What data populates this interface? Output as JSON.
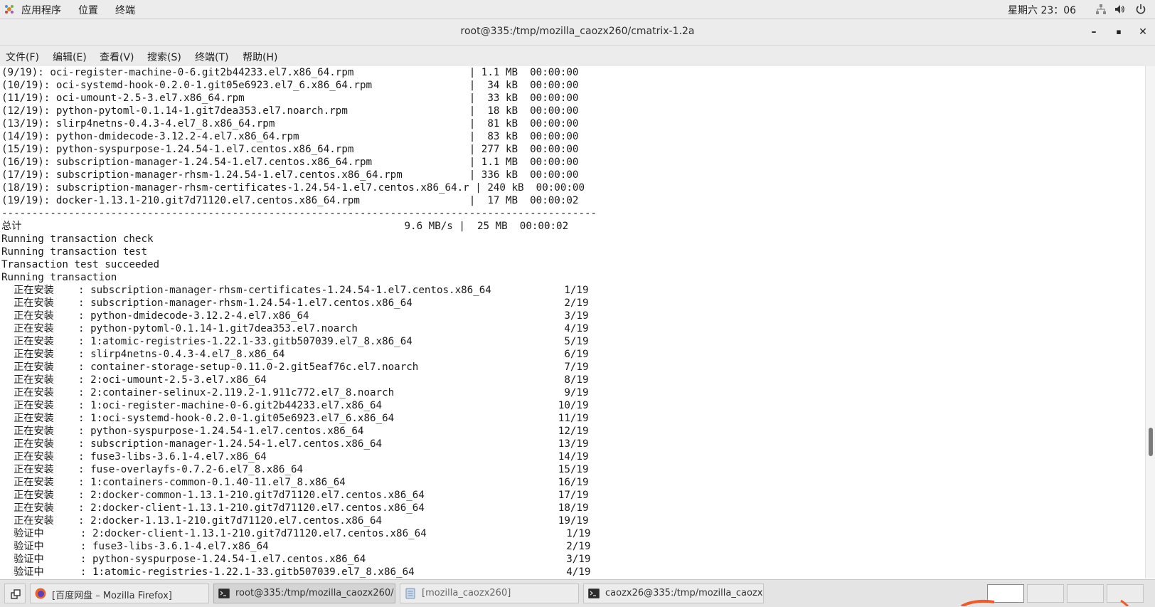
{
  "top_panel": {
    "menus": [
      "应用程序",
      "位置",
      "终端"
    ],
    "clock": "星期六 23：06"
  },
  "window": {
    "title": "root@335:/tmp/mozilla_caozx260/cmatrix-1.2a"
  },
  "menubar": [
    "文件(F)",
    "编辑(E)",
    "查看(V)",
    "搜索(S)",
    "终端(T)",
    "帮助(H)"
  ],
  "terminal_lines": [
    "(9/19): oci-register-machine-0-6.git2b44233.el7.x86_64.rpm                   | 1.1 MB  00:00:00",
    "(10/19): oci-systemd-hook-0.2.0-1.git05e6923.el7_6.x86_64.rpm                |  34 kB  00:00:00",
    "(11/19): oci-umount-2.5-3.el7.x86_64.rpm                                     |  33 kB  00:00:00",
    "(12/19): python-pytoml-0.1.14-1.git7dea353.el7.noarch.rpm                    |  18 kB  00:00:00",
    "(13/19): slirp4netns-0.4.3-4.el7_8.x86_64.rpm                                |  81 kB  00:00:00",
    "(14/19): python-dmidecode-3.12.2-4.el7.x86_64.rpm                            |  83 kB  00:00:00",
    "(15/19): python-syspurpose-1.24.54-1.el7.centos.x86_64.rpm                   | 277 kB  00:00:00",
    "(16/19): subscription-manager-1.24.54-1.el7.centos.x86_64.rpm                | 1.1 MB  00:00:00",
    "(17/19): subscription-manager-rhsm-1.24.54-1.el7.centos.x86_64.rpm           | 336 kB  00:00:00",
    "(18/19): subscription-manager-rhsm-certificates-1.24.54-1.el7.centos.x86_64.r | 240 kB  00:00:00",
    "(19/19): docker-1.13.1-210.git7d71120.el7.centos.x86_64.rpm                  |  17 MB  00:00:02",
    "--------------------------------------------------------------------------------------------------",
    "总计                                                               9.6 MB/s |  25 MB  00:00:02",
    "Running transaction check",
    "Running transaction test",
    "Transaction test succeeded",
    "Running transaction",
    "  正在安装    : subscription-manager-rhsm-certificates-1.24.54-1.el7.centos.x86_64            1/19",
    "  正在安装    : subscription-manager-rhsm-1.24.54-1.el7.centos.x86_64                         2/19",
    "  正在安装    : python-dmidecode-3.12.2-4.el7.x86_64                                          3/19",
    "  正在安装    : python-pytoml-0.1.14-1.git7dea353.el7.noarch                                  4/19",
    "  正在安装    : 1:atomic-registries-1.22.1-33.gitb507039.el7_8.x86_64                         5/19",
    "  正在安装    : slirp4netns-0.4.3-4.el7_8.x86_64                                              6/19",
    "  正在安装    : container-storage-setup-0.11.0-2.git5eaf76c.el7.noarch                        7/19",
    "  正在安装    : 2:oci-umount-2.5-3.el7.x86_64                                                 8/19",
    "  正在安装    : 2:container-selinux-2.119.2-1.911c772.el7_8.noarch                            9/19",
    "  正在安装    : 1:oci-register-machine-0-6.git2b44233.el7.x86_64                             10/19",
    "  正在安装    : 1:oci-systemd-hook-0.2.0-1.git05e6923.el7_6.x86_64                           11/19",
    "  正在安装    : python-syspurpose-1.24.54-1.el7.centos.x86_64                                12/19",
    "  正在安装    : subscription-manager-1.24.54-1.el7.centos.x86_64                             13/19",
    "  正在安装    : fuse3-libs-3.6.1-4.el7.x86_64                                                14/19",
    "  正在安装    : fuse-overlayfs-0.7.2-6.el7_8.x86_64                                          15/19",
    "  正在安装    : 1:containers-common-0.1.40-11.el7_8.x86_64                                   16/19",
    "  正在安装    : 2:docker-common-1.13.1-210.git7d71120.el7.centos.x86_64                      17/19",
    "  正在安装    : 2:docker-client-1.13.1-210.git7d71120.el7.centos.x86_64                      18/19",
    "  正在安装    : 2:docker-1.13.1-210.git7d71120.el7.centos.x86_64                             19/19",
    "  验证中      : 2:docker-client-1.13.1-210.git7d71120.el7.centos.x86_64                       1/19",
    "  验证中      : fuse3-libs-3.6.1-4.el7.x86_64                                                 2/19",
    "  验证中      : python-syspurpose-1.24.54-1.el7.centos.x86_64                                 3/19",
    "  验证中      : 1:atomic-registries-1.22.1-33.gitb507039.el7_8.x86_64                         4/19"
  ],
  "taskbar": {
    "tasks": [
      {
        "label": "[百度网盘 – Mozilla Firefox]",
        "icon": "firefox-icon"
      },
      {
        "label": "root@335:/tmp/mozilla_caozx260/…",
        "icon": "terminal-icon"
      },
      {
        "label": "[mozilla_caozx260]",
        "icon": "folder-icon"
      },
      {
        "label": "caozx26@335:/tmp/mozilla_caozx…",
        "icon": "terminal-icon"
      }
    ]
  }
}
